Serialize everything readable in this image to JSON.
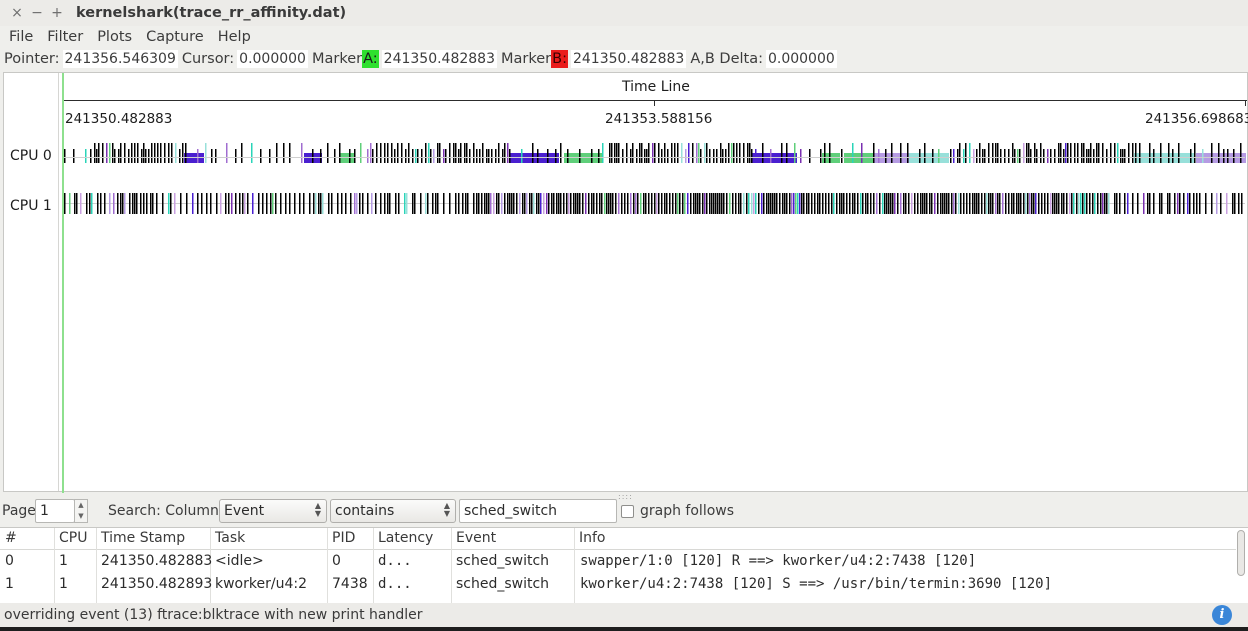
{
  "window": {
    "title": "kernelshark(trace_rr_affinity.dat)",
    "close": "×",
    "minimize": "−",
    "maximize": "+"
  },
  "menu": [
    "File",
    "Filter",
    "Plots",
    "Capture",
    "Help"
  ],
  "info": {
    "pointer_label": "Pointer:",
    "pointer_value": "241356.546309",
    "cursor_label": "Cursor:",
    "cursor_value": "0.000000",
    "marker_label": "Marker",
    "marker_a_letter": "A:",
    "marker_a_value": "241350.482883",
    "marker_b_letter": "B:",
    "marker_b_value": "241350.482883",
    "delta_label": "A,B Delta:",
    "delta_value": "0.000000",
    "marker_a_color": "#2ee02e",
    "marker_b_color": "#ea1c1c"
  },
  "graph": {
    "timeline_title": "Time Line",
    "ticks": [
      "241350.482883",
      "241353.588156",
      "241356.698683"
    ],
    "cpus": [
      "CPU 0",
      "CPU 1"
    ],
    "task_colors": [
      "#000000",
      "#4a1fd0",
      "#5fcf7a",
      "#a06dd0",
      "#98e0da",
      "#b59be3",
      "#2ad4b8",
      "#7a2fb0",
      "#c9a0e0"
    ]
  },
  "search": {
    "page_label": "Page",
    "page_value": "1",
    "search_label": "Search: Column:",
    "column_value": "Event",
    "mode_value": "contains",
    "text_value": "sched_switch",
    "graph_follows_label": "graph follows"
  },
  "table": {
    "headers": [
      "#",
      "CPU",
      "Time Stamp",
      "Task",
      "PID",
      "Latency",
      "Event",
      "Info"
    ],
    "rows": [
      [
        "0",
        "1",
        "241350.482883",
        "<idle>",
        "0",
        "d...",
        "sched_switch",
        "swapper/1:0 [120] R ==> kworker/u4:2:7438 [120]"
      ],
      [
        "1",
        "1",
        "241350.482893",
        "kworker/u4:2",
        "7438",
        "d...",
        "sched_switch",
        "kworker/u4:2:7438 [120] S ==> /usr/bin/termin:3690 [120]"
      ]
    ]
  },
  "status": {
    "message": "overriding event (13) ftrace:blktrace with new print handler",
    "info_icon": "i"
  }
}
